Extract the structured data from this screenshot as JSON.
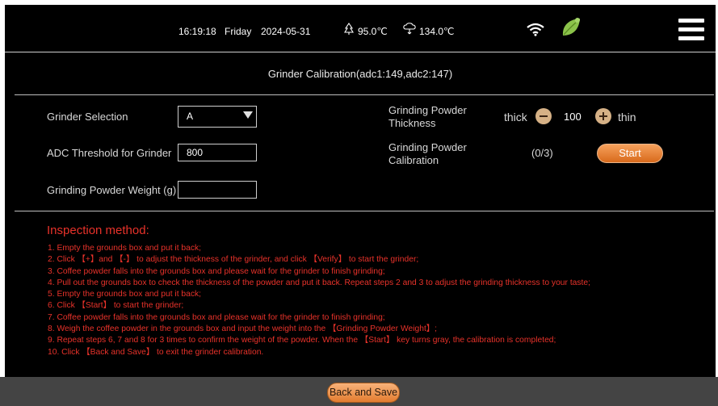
{
  "status_bar": {
    "time": "16:19:18",
    "day": "Friday",
    "date": "2024-05-31",
    "temp1": "95.0℃",
    "temp2": "134.0℃"
  },
  "title": "Grinder Calibration(adc1:149,adc2:147)",
  "form": {
    "grinder_selection_label": "Grinder Selection",
    "grinder_selection_value": "A",
    "adc_threshold_label": "ADC Threshold for Grinder",
    "adc_threshold_value": "800",
    "powder_weight_label": "Grinding Powder Weight (g)",
    "powder_weight_value": "",
    "thickness_label_line1": "Grinding Powder",
    "thickness_label_line2": "Thickness",
    "thick_label": "thick",
    "thickness_value": "100",
    "thin_label": "thin",
    "calibration_label_line1": "Grinding Powder",
    "calibration_label_line2": "Calibration",
    "calibration_progress": "(0/3)",
    "start_label": "Start"
  },
  "inspection": {
    "title": "Inspection method:",
    "steps": [
      "1. Empty the grounds box and put it back;",
      "2. Click 【+】and 【-】 to adjust the thickness of the grinder, and click 【Verify】 to start the grinder;",
      "3. Coffee powder falls into the grounds box and please wait for the grinder to finish grinding;",
      "4. Pull out the grounds box to check the thickness of the powder and put it back. Repeat steps 2 and 3 to adjust the grinding thickness to your taste;",
      "5. Empty the grounds box and put it back;",
      "6. Click 【Start】 to start the grinder;",
      "7. Coffee powder falls into the grounds box and please wait for the grinder to finish grinding;",
      "8. Weigh the coffee powder in the grounds box and input the weight into the 【Grinding Powder Weight】;",
      "9. Repeat steps 6, 7 and 8 for 3 times to confirm the weight of the powder. When the 【Start】 key turns gray, the calibration is completed;",
      "10. Click 【Back and Save】 to exit the grinder calibration."
    ]
  },
  "back_and_save_label": "Back and Save",
  "colors": {
    "accent_orange": "#e37c2f",
    "instruction_red": "#e8322a",
    "leaf_green": "#8bc34a"
  },
  "icons": [
    "boiler-temp-icon",
    "steam-temp-icon",
    "wifi-icon",
    "leaf-icon",
    "menu-icon",
    "dropdown-arrow-icon",
    "minus-icon",
    "plus-icon"
  ]
}
